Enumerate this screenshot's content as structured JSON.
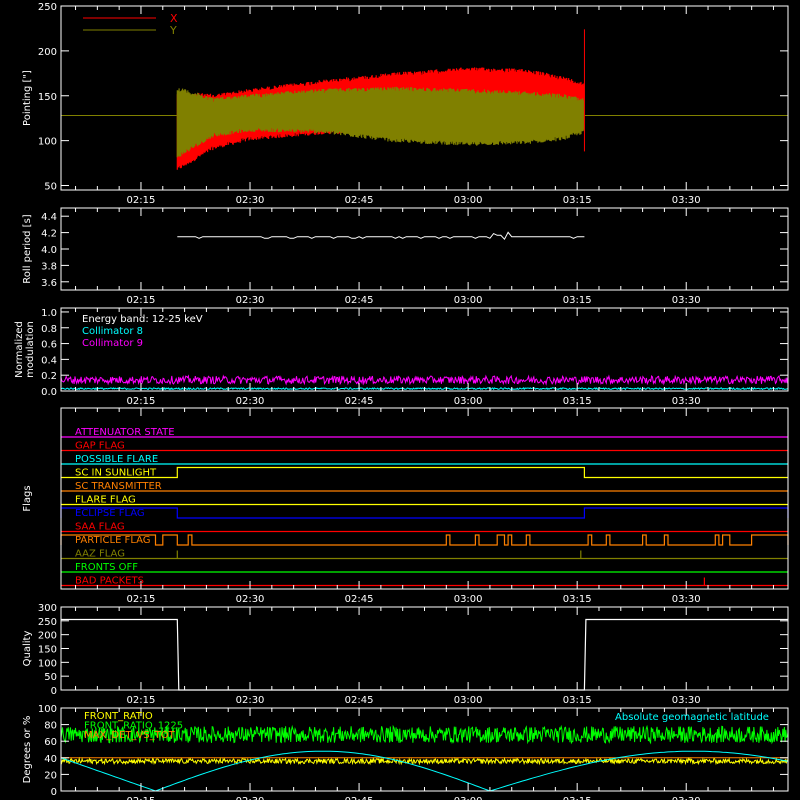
{
  "time_ticks": [
    "02:15",
    "02:30",
    "02:45",
    "03:00",
    "03:15",
    "03:30"
  ],
  "time_range": {
    "start_min": 124,
    "end_min": 224,
    "ticks_min": [
      135,
      150,
      165,
      180,
      195,
      210
    ]
  },
  "colors": {
    "axis": "#ffffff",
    "x": "#ff0000",
    "y": "#808000",
    "white": "#ffffff",
    "cyan": "#00ffff",
    "magenta": "#ff00ff",
    "yellow": "#ffff00",
    "green": "#00ff00",
    "orange": "#ff8000",
    "blue": "#0000ff",
    "red": "#ff0000",
    "olive": "#808000"
  },
  "chart_data": [
    {
      "id": "pointing",
      "type": "line",
      "ylabel": "Pointing [\"]",
      "yticks": [
        "50",
        "100",
        "150",
        "200",
        "250"
      ],
      "ylim": [
        45,
        250
      ],
      "legend": [
        {
          "label": "X",
          "color": "#ff0000"
        },
        {
          "label": "Y",
          "color": "#808000"
        }
      ],
      "baseline": 128,
      "series": [
        {
          "name": "X",
          "color": "#ff0000",
          "x_min": [
            140,
            145,
            150,
            160,
            170,
            180,
            188,
            193,
            196
          ],
          "upper": [
            155,
            152,
            158,
            168,
            176,
            182,
            180,
            172,
            165
          ],
          "lower": [
            66,
            90,
            100,
            107,
            108,
            110,
            113,
            110,
            110
          ]
        },
        {
          "name": "Y",
          "color": "#808000",
          "x_min": [
            140,
            145,
            150,
            160,
            170,
            180,
            188,
            193,
            196
          ],
          "upper": [
            160,
            148,
            152,
            158,
            160,
            158,
            155,
            152,
            148
          ],
          "lower": [
            80,
            104,
            110,
            108,
            98,
            94,
            96,
            100,
            108
          ]
        }
      ],
      "spike": {
        "x_min": 196,
        "top": 224,
        "bottom": 88
      }
    },
    {
      "id": "roll",
      "type": "line",
      "ylabel": "Roll period [s]",
      "yticks": [
        "3.6",
        "3.8",
        "4.0",
        "4.2",
        "4.4"
      ],
      "ylim": [
        3.5,
        4.5
      ],
      "series": [
        {
          "name": "",
          "color": "#ffffff",
          "x_range_min": [
            140,
            196
          ],
          "value": 4.15
        }
      ]
    },
    {
      "id": "modulation",
      "type": "line",
      "ylabel": "Normalized modulation",
      "yticks": [
        "0.0",
        "0.2",
        "0.4",
        "0.6",
        "0.8",
        "1.0"
      ],
      "ylim": [
        0,
        1.05
      ],
      "annotations": [
        {
          "text": "Energy band: 12-25 keV",
          "color": "#ffffff"
        },
        {
          "text": "Collimator 8",
          "color": "#00ffff"
        },
        {
          "text": "Collimator 9",
          "color": "#ff00ff"
        }
      ],
      "series": [
        {
          "name": "Collimator 8",
          "color": "#00ffff",
          "value": 0.03
        },
        {
          "name": "Collimator 9",
          "color": "#ff00ff",
          "value": 0.14
        }
      ]
    },
    {
      "id": "flags",
      "type": "line",
      "ylabel": "Flags",
      "rows": [
        {
          "label": "ATTENUATOR STATE",
          "color": "#ff00ff"
        },
        {
          "label": "GAP FLAG",
          "color": "#ff0000"
        },
        {
          "label": "POSSIBLE FLARE",
          "color": "#00ffff"
        },
        {
          "label": "SC IN SUNLIGHT",
          "color": "#ffff00",
          "high_range_min": [
            140,
            196
          ]
        },
        {
          "label": "SC TRANSMITTER",
          "color": "#ff8000"
        },
        {
          "label": "FLARE FLAG",
          "color": "#ffff00"
        },
        {
          "label": "ECLIPSE FLAG",
          "color": "#0000ff",
          "high_ranges_min": [
            [
              124,
              140
            ],
            [
              196,
              224
            ]
          ]
        },
        {
          "label": "SAA FLAG",
          "color": "#ff0000"
        },
        {
          "label": "PARTICLE FLAG",
          "color": "#ff8000",
          "high_ranges_min": [
            [
              124,
              137
            ],
            [
              138,
              140
            ],
            [
              141.5,
              142
            ],
            [
              177,
              177.5
            ],
            [
              181,
              181.5
            ],
            [
              184,
              185
            ],
            [
              185.5,
              186
            ],
            [
              188,
              188.5
            ],
            [
              196.5,
              197
            ],
            [
              199,
              199.5
            ],
            [
              204,
              204.5
            ],
            [
              207,
              207.5
            ],
            [
              214,
              214.5
            ],
            [
              215,
              216
            ],
            [
              219,
              224
            ]
          ]
        },
        {
          "label": "AAZ FLAG",
          "color": "#808000",
          "spikes_min": [
            140,
            195.5
          ]
        },
        {
          "label": "FRONTS OFF",
          "color": "#00ff00"
        },
        {
          "label": "BAD PACKETS",
          "color": "#ff0000",
          "spikes_min": [
            212.5
          ]
        }
      ]
    },
    {
      "id": "quality",
      "type": "line",
      "ylabel": "Quality",
      "yticks": [
        "0",
        "50",
        "100",
        "150",
        "200",
        "250",
        "300"
      ],
      "ylim": [
        0,
        300
      ],
      "series": [
        {
          "name": "",
          "color": "#ffffff",
          "points": [
            [
              124,
              255
            ],
            [
              140,
              255
            ],
            [
              140.2,
              0
            ],
            [
              196,
              0
            ],
            [
              196.2,
              255
            ],
            [
              224,
              255
            ]
          ]
        }
      ]
    },
    {
      "id": "ratios",
      "type": "line",
      "ylabel": "Degrees or %",
      "yticks": [
        "0",
        "20",
        "40",
        "60",
        "80",
        "100"
      ],
      "ylim": [
        0,
        100
      ],
      "legend": [
        {
          "label": "FRONT_RATIO",
          "color": "#ffff00"
        },
        {
          "label": "FRONT_RATIO_1225",
          "color": "#00ff00"
        },
        {
          "label": "MAX_DET_VS_TOT",
          "color": "#ff8000"
        }
      ],
      "annotation": {
        "text": "Absolute geomagnetic latitude",
        "color": "#00ffff"
      },
      "series": [
        {
          "name": "FRONT_RATIO",
          "color": "#ffff00",
          "value": 36
        },
        {
          "name": "FRONT_RATIO_1225",
          "color": "#00ff00",
          "value": 68
        },
        {
          "name": "MAX_DET_VS_TOT",
          "color": "#ff8000",
          "value": 40
        },
        {
          "name": "Absolute geomagnetic latitude",
          "color": "#00ffff",
          "points": [
            [
              124,
              40
            ],
            [
              137,
              0
            ],
            [
              165,
              48
            ],
            [
              180,
              2
            ],
            [
              184,
              0
            ],
            [
              211,
              48
            ],
            [
              224,
              38
            ]
          ]
        }
      ]
    }
  ]
}
